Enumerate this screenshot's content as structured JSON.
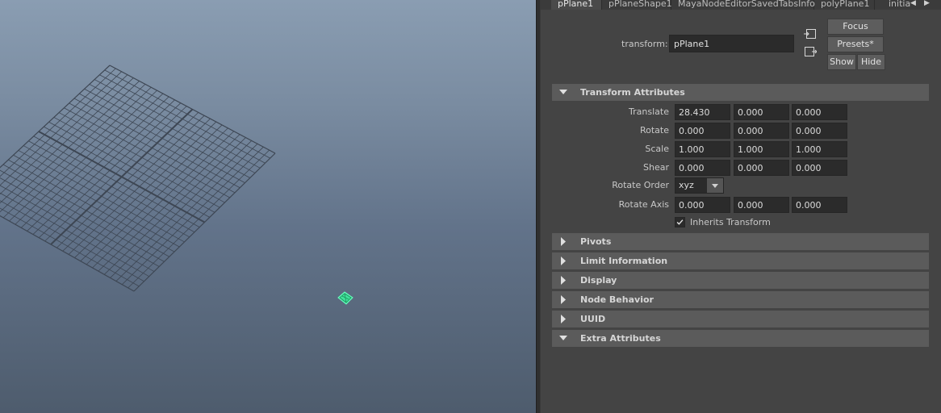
{
  "attribute_editor": {
    "tabs": [
      {
        "label": "pPlane1",
        "active": true
      },
      {
        "label": "pPlaneShape1",
        "active": false
      },
      {
        "label": "MayaNodeEditorSavedTabsInfo",
        "active": false
      },
      {
        "label": "polyPlane1",
        "active": false
      },
      {
        "label": "initia",
        "active": false
      }
    ],
    "node_type_label": "transform:",
    "node_name": "pPlane1",
    "buttons": {
      "focus": "Focus",
      "presets": "Presets*",
      "show": "Show",
      "hide": "Hide"
    },
    "sections": {
      "transform_attributes": {
        "label": "Transform Attributes",
        "expanded": true
      },
      "pivots": {
        "label": "Pivots",
        "expanded": false
      },
      "limit_information": {
        "label": "Limit Information",
        "expanded": false
      },
      "display": {
        "label": "Display",
        "expanded": false
      },
      "node_behavior": {
        "label": "Node Behavior",
        "expanded": false
      },
      "uuid": {
        "label": "UUID",
        "expanded": false
      },
      "extra_attributes": {
        "label": "Extra Attributes",
        "expanded": true
      }
    },
    "transform": {
      "translate": {
        "label": "Translate",
        "values": [
          "28.430",
          "0.000",
          "0.000"
        ]
      },
      "rotate": {
        "label": "Rotate",
        "values": [
          "0.000",
          "0.000",
          "0.000"
        ]
      },
      "scale": {
        "label": "Scale",
        "values": [
          "1.000",
          "1.000",
          "1.000"
        ]
      },
      "shear": {
        "label": "Shear",
        "values": [
          "0.000",
          "0.000",
          "0.000"
        ]
      },
      "rotate_order": {
        "label": "Rotate Order",
        "value": "xyz"
      },
      "rotate_axis": {
        "label": "Rotate Axis",
        "values": [
          "0.000",
          "0.000",
          "0.000"
        ]
      },
      "inherits_transform": {
        "label": "Inherits Transform",
        "checked": true
      }
    }
  },
  "colors": {
    "selected_object": "#3fe39a",
    "grid_lines": "#3d4653"
  },
  "icons": {
    "expanded": "triangle-down-icon",
    "collapsed": "triangle-right-icon",
    "tab_scroll_left": "triangle-left-icon",
    "tab_scroll_right": "triangle-right-icon"
  }
}
